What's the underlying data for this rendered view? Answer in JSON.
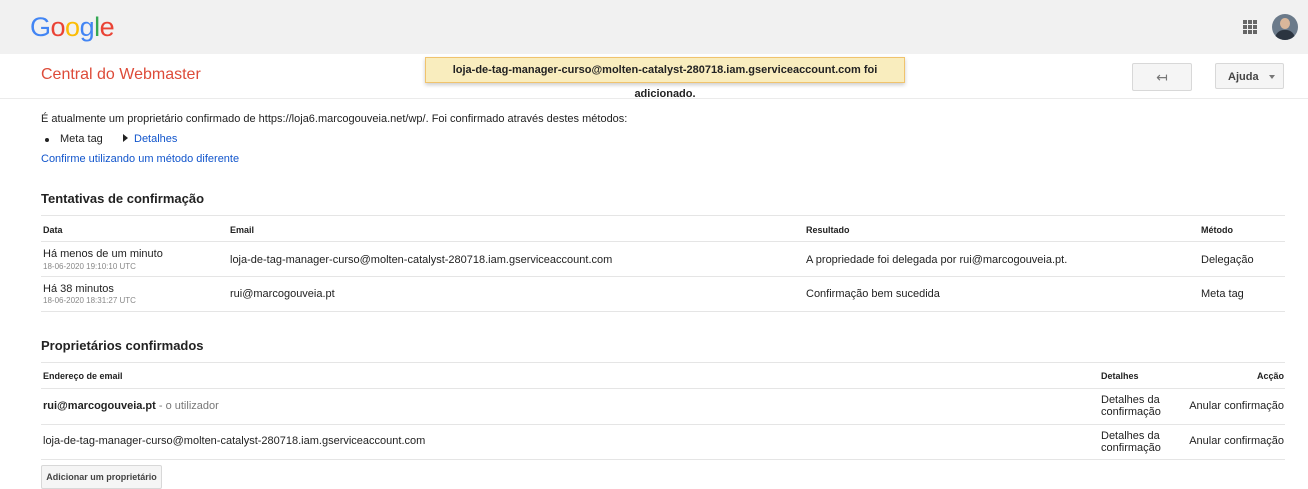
{
  "header": {
    "logo_letters": [
      {
        "char": "G",
        "color": "#4285f4"
      },
      {
        "char": "o",
        "color": "#ea4335"
      },
      {
        "char": "o",
        "color": "#fbbc05"
      },
      {
        "char": "g",
        "color": "#4285f4"
      },
      {
        "char": "l",
        "color": "#34a853"
      },
      {
        "char": "e",
        "color": "#ea4335"
      }
    ],
    "app_title": "Central do Webmaster",
    "notification": "loja-de-tag-manager-curso@molten-catalyst-280718.iam.gserviceaccount.com foi adicionado.",
    "back_glyph": "↤",
    "help_label": "Ajuda"
  },
  "intro": {
    "statement": "É atualmente um proprietário confirmado de https://loja6.marcogouveia.net/wp/. Foi confirmado através destes métodos:",
    "method": "Meta tag",
    "details_link": "Detalhes",
    "alternate_method_link": "Confirme utilizando um método diferente"
  },
  "attempts": {
    "title": "Tentativas de confirmação",
    "columns": [
      "Data",
      "Email",
      "Resultado",
      "Método"
    ],
    "rows": [
      {
        "date": "Há menos de um minuto",
        "timestamp": "18-06-2020 19:10:10 UTC",
        "email": "loja-de-tag-manager-curso@molten-catalyst-280718.iam.gserviceaccount.com",
        "result": "A propriedade foi delegada por rui@marcogouveia.pt.",
        "method": "Delegação"
      },
      {
        "date": "Há 38 minutos",
        "timestamp": "18-06-2020 18:31:27 UTC",
        "email": "rui@marcogouveia.pt",
        "result": "Confirmação bem sucedida",
        "method": "Meta tag"
      }
    ]
  },
  "owners": {
    "title": "Proprietários confirmados",
    "columns": [
      "Endereço de email",
      "Detalhes",
      "Acção"
    ],
    "rows": [
      {
        "email": "rui@marcogouveia.pt",
        "note": " - o utilizador",
        "details_line1": "Detalhes da",
        "details_line2": "confirmação",
        "action": "Anular confirmação"
      },
      {
        "email": "loja-de-tag-manager-curso@molten-catalyst-280718.iam.gserviceaccount.com",
        "note": "",
        "details_line1": "Detalhes da",
        "details_line2": "confirmação",
        "action": "Anular confirmação"
      }
    ],
    "add_button": "Adicionar um proprietário"
  },
  "colors": {
    "brand_red": "#dd4b39",
    "link_blue": "#1155cc",
    "toast_bg": "#f9edbe"
  }
}
